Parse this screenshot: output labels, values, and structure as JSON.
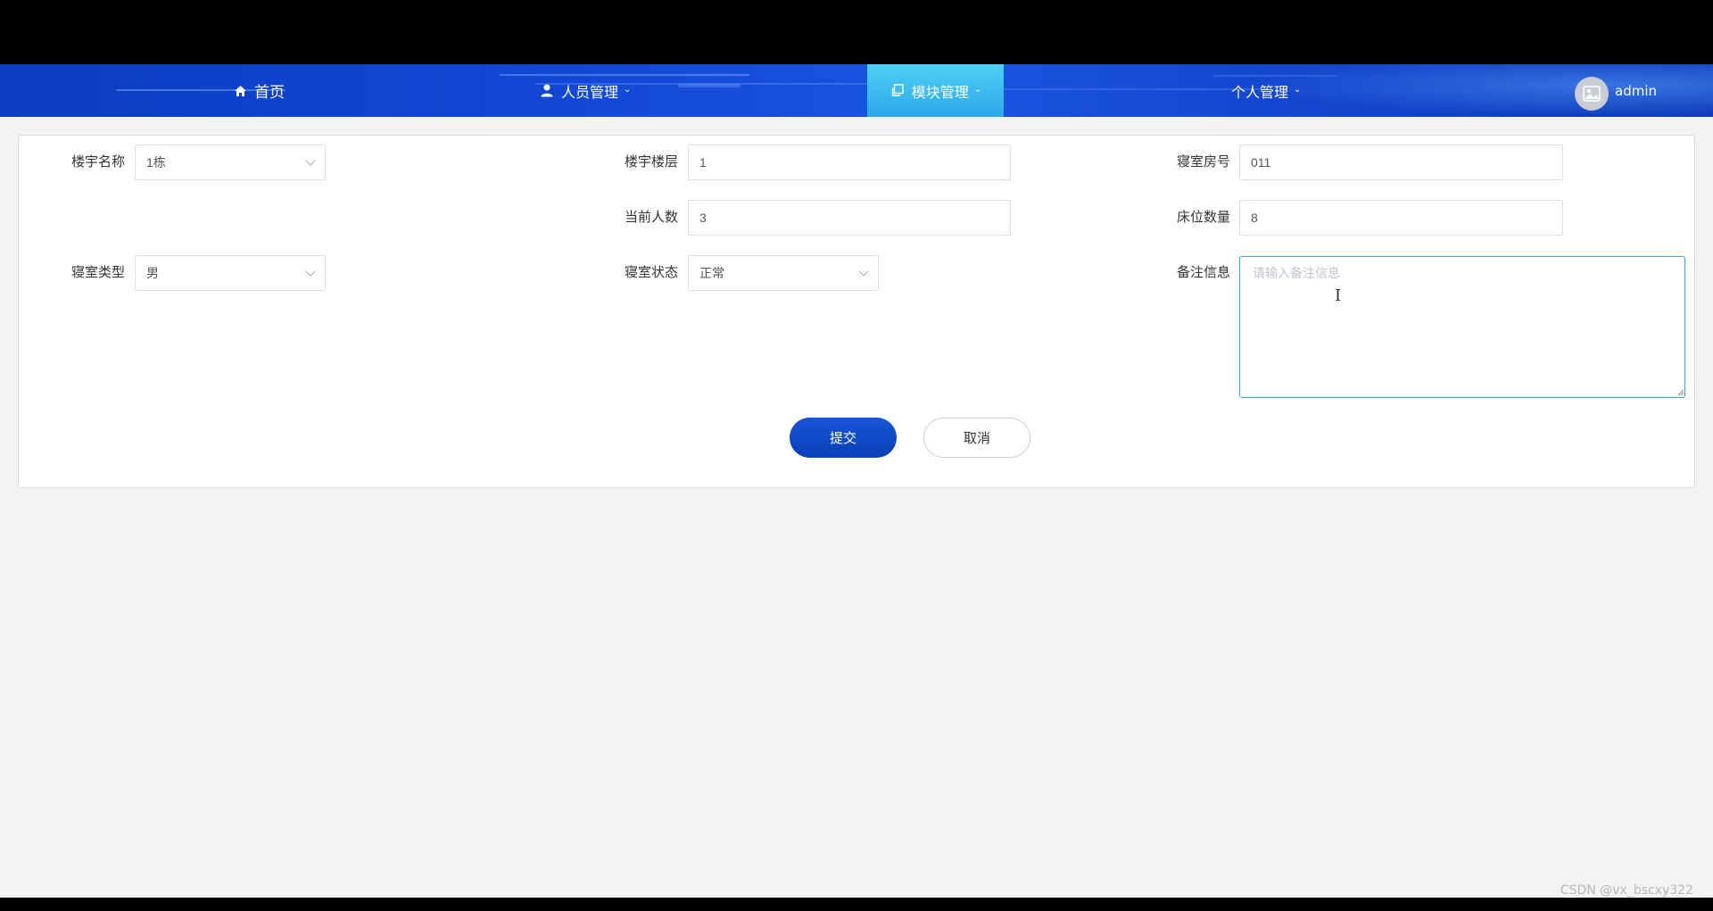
{
  "nav": {
    "home": "首页",
    "personnel": "人员管理",
    "modules": "模块管理",
    "personal": "个人管理",
    "user": "admin",
    "active_color": "#2aa8e8",
    "bar_color": "#1146d3"
  },
  "form": {
    "building_name": {
      "label": "楼宇名称",
      "value": "1栋"
    },
    "building_floor": {
      "label": "楼宇楼层",
      "value": "1"
    },
    "room_number": {
      "label": "寝室房号",
      "value": "011"
    },
    "current_count": {
      "label": "当前人数",
      "value": "3"
    },
    "bed_count": {
      "label": "床位数量",
      "value": "8"
    },
    "room_type": {
      "label": "寝室类型",
      "value": "男"
    },
    "room_status": {
      "label": "寝室状态",
      "value": "正常"
    },
    "remarks": {
      "label": "备注信息",
      "placeholder": "请输入备注信息",
      "value": ""
    }
  },
  "buttons": {
    "submit": "提交",
    "cancel": "取消"
  },
  "watermark": "CSDN @vx_bscxy322"
}
